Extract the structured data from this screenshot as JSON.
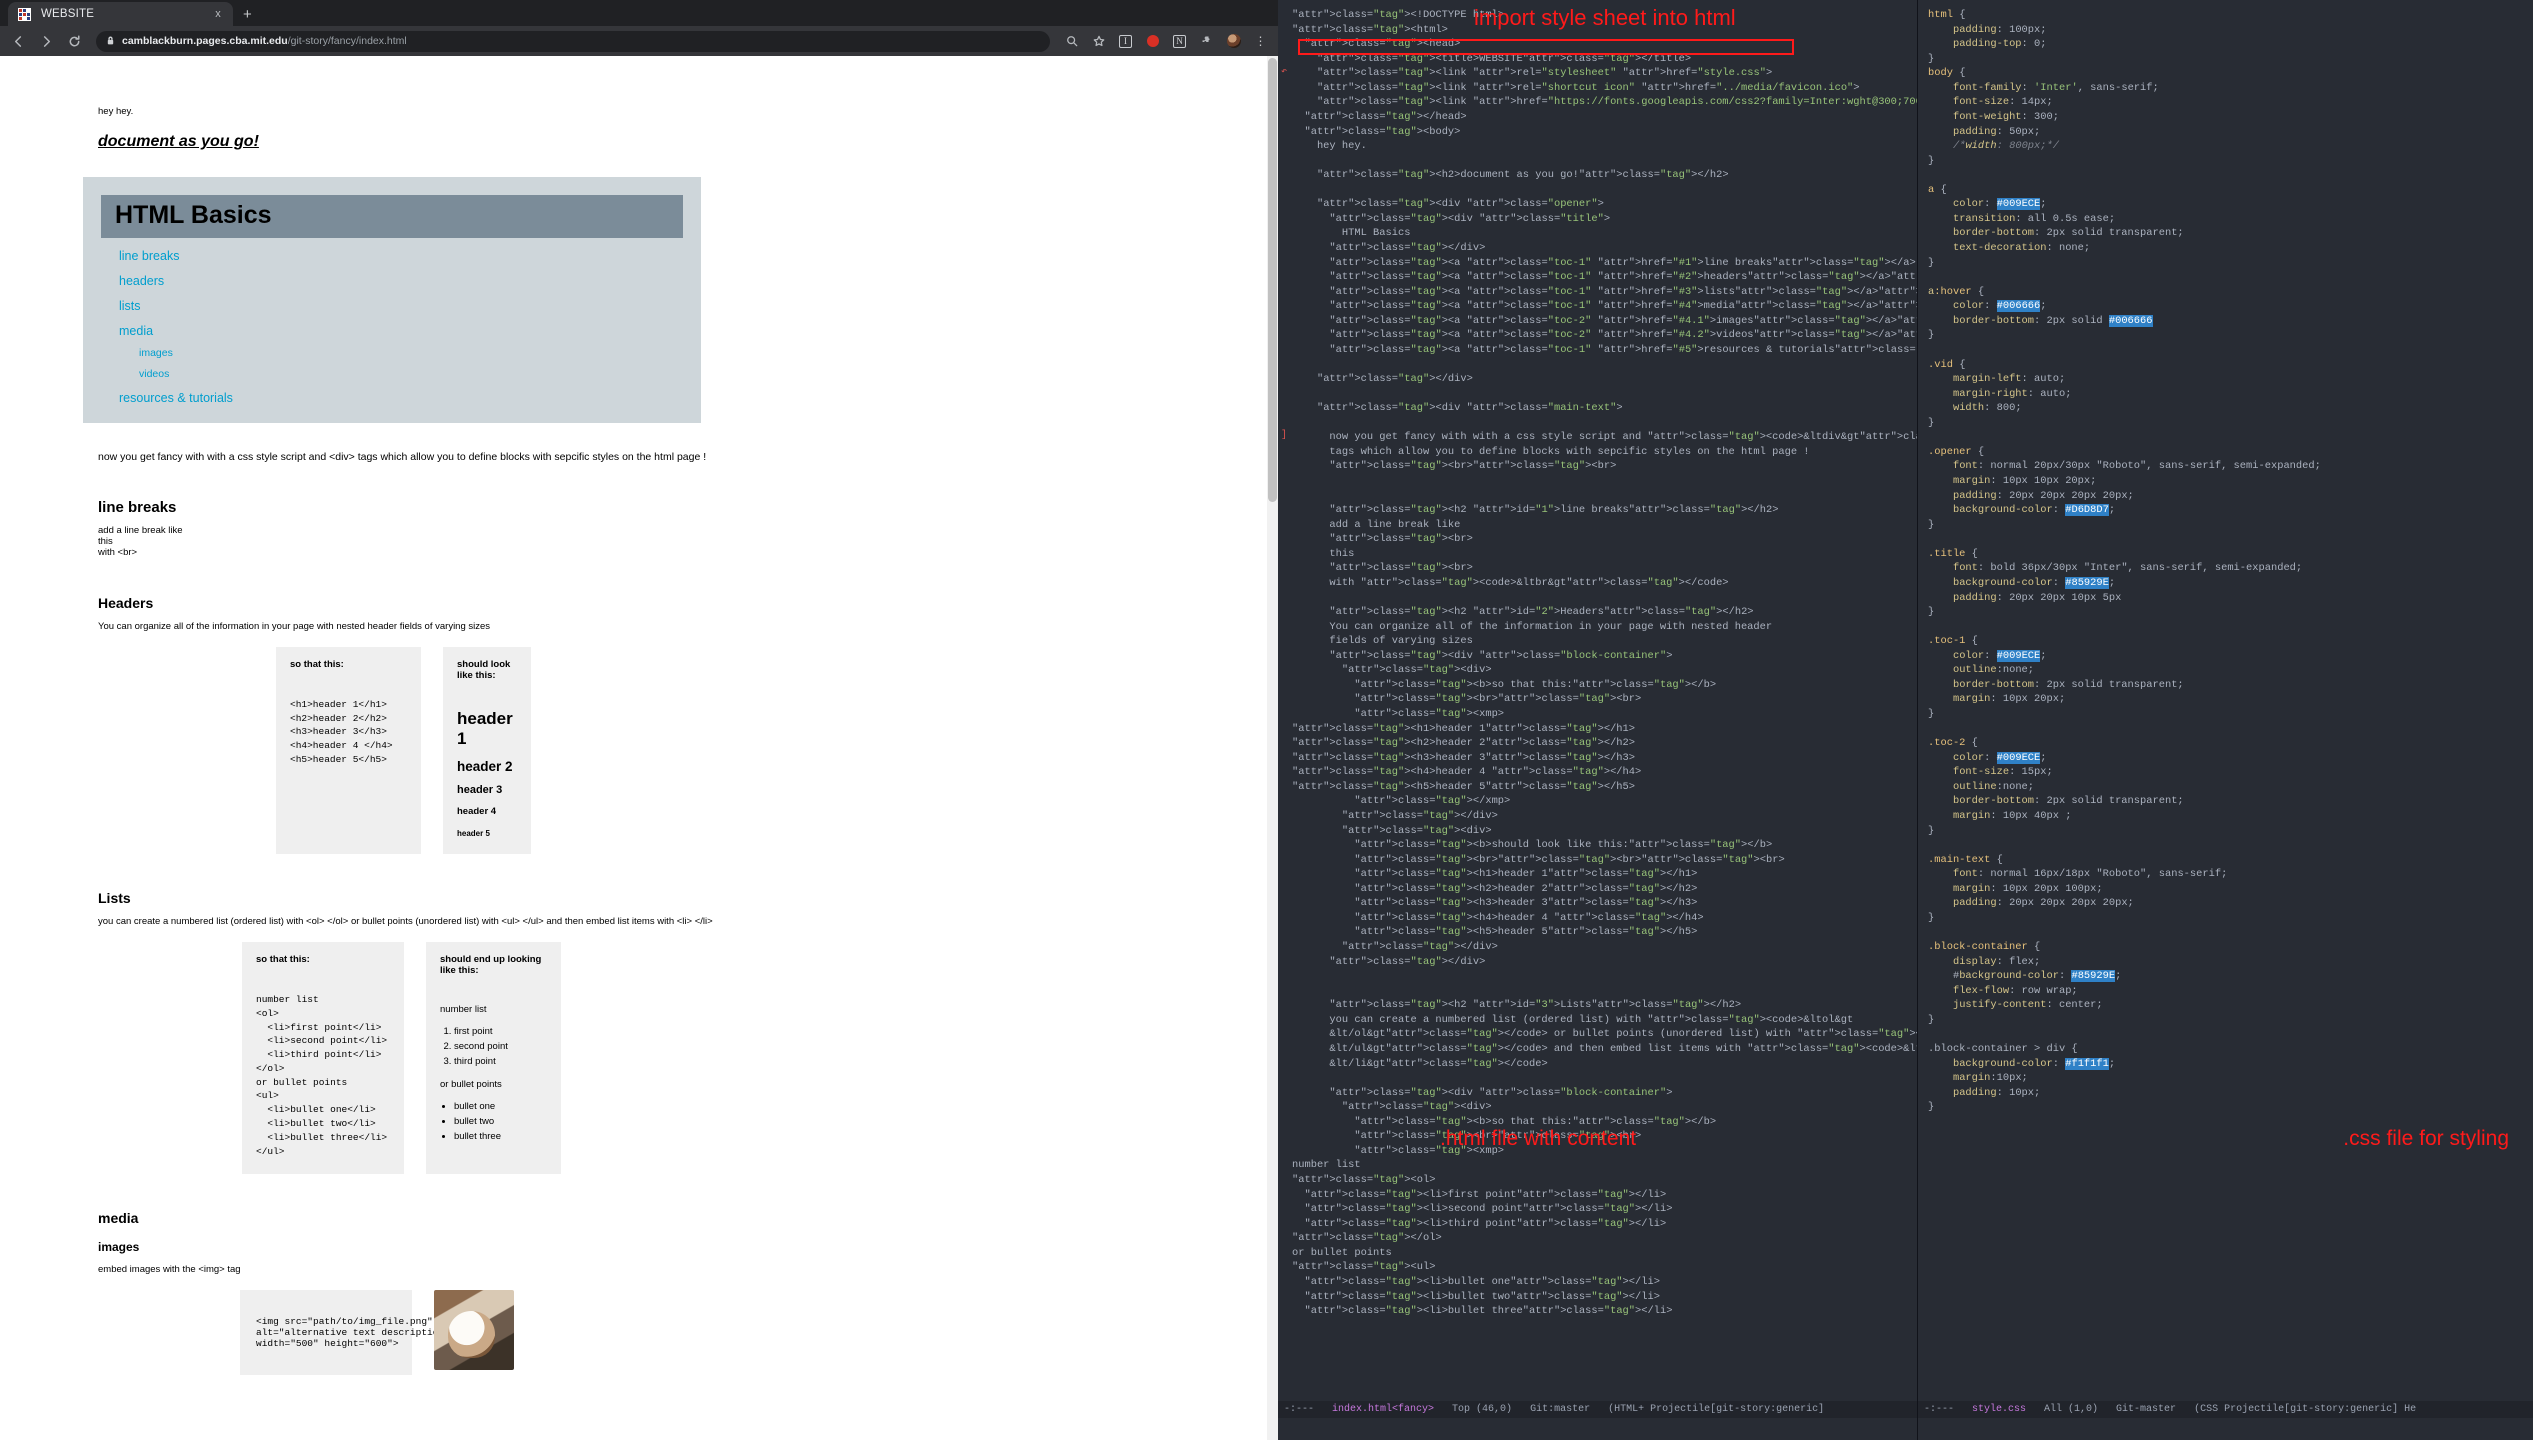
{
  "browser": {
    "tab": {
      "title": "WEBSITE",
      "close_label": "x",
      "favicon": "website-favicon"
    },
    "new_tab_label": "+",
    "nav": {
      "back": "←",
      "forward": "→",
      "reload": "↻"
    },
    "omnibox": {
      "domain": "camblackburn.pages.cba.mit.edu",
      "path": "/git-story/fancy/index.html",
      "lock_icon": "lock-icon"
    },
    "toolbar_icons": [
      "search-icon",
      "bookmark-star-icon",
      "info-badge-icon",
      "red-circle-icon",
      "notion-icon",
      "extensions-puzzle-icon",
      "profile-avatar",
      "chrome-menu-kebab"
    ]
  },
  "page": {
    "hey": "hey hey.",
    "h2": "document as you go!",
    "opener_title": "HTML Basics",
    "toc": [
      {
        "label": "line breaks",
        "level": 1
      },
      {
        "label": "headers",
        "level": 1
      },
      {
        "label": "lists",
        "level": 1
      },
      {
        "label": "media",
        "level": 1
      },
      {
        "label": "images",
        "level": 2
      },
      {
        "label": "videos",
        "level": 2
      },
      {
        "label": "resources & tutorials",
        "level": 1
      }
    ],
    "main_text": "now you get fancy with with a css style script and <div> tags which allow you to define blocks with sepcific styles on the html page !",
    "sections": [
      {
        "id": "line-breaks",
        "heading": "line breaks",
        "lines": [
          "add a line break like",
          "this",
          "with <br>"
        ]
      },
      {
        "id": "headers",
        "heading": "Headers",
        "para": "You can organize all of the information in your page with nested header fields of varying sizes",
        "left_title": "so that this:",
        "left_code": "<h1>header 1</h1>\n<h2>header 2</h2>\n<h3>header 3</h3>\n<h4>header 4 </h4>\n<h5>header 5</h5>",
        "right_title": "should look like this:",
        "preview": [
          "header 1",
          "header 2",
          "header 3",
          "header 4",
          "header 5"
        ]
      },
      {
        "id": "lists",
        "heading": "Lists",
        "para": "you can create a numbered list (ordered list) with <ol> </ol> or bullet points (unordered list) with <ul> </ul> and then embed list items with <li> </li>",
        "left_title": "so that this:",
        "left_code": "number list\n<ol>\n  <li>first point</li>\n  <li>second point</li>\n  <li>third point</li>\n</ol>\nor bullet points\n<ul>\n  <li>bullet one</li>\n  <li>bullet two</li>\n  <li>bullet three</li>\n</ul>",
        "right_title": "should end up looking like this:",
        "ordered_label": "number list",
        "ordered": [
          "first point",
          "second point",
          "third point"
        ],
        "unordered_label": "or bullet points",
        "unordered": [
          "bullet one",
          "bullet two",
          "bullet three"
        ]
      },
      {
        "id": "media",
        "heading": "media",
        "sub_heading": "images",
        "para": "embed images with the <img> tag",
        "img_code": "<img src=\"path/to/img_file.png\"\nalt=\"alternative text description\"\nwidth=\"500\" height=\"600\">",
        "photo_alt": "dog-photo"
      }
    ]
  },
  "editor": {
    "annotations": {
      "import": "import style sheet into html",
      "html_file": ".html file with content",
      "css_file": ".css file for styling"
    },
    "html_pane": {
      "code_lines": "<!DOCTYPE html>\n<html>\n  <head>\n    <title>WEBSITE</title>\n    <link rel=\"stylesheet\" href=\"style.css\">\n    <link rel=\"shortcut icon\" href=\"../media/favicon.ico\">\n    <link href=\"https://fonts.googleapis.com/css2?family=Inter:wght@300;700;400&display=swap\" rel=\"stylesheet\">\n  </head>\n  <body>\n    hey hey.\n\n    <h2>document as you go!</h2>\n\n    <div class=\"opener\">\n      <div class=\"title\">\n        HTML Basics\n      </div>\n      <a class=\"toc-1\" href=\"#1\">line breaks</a><br>\n      <a class=\"toc-1\" href=\"#2\">headers</a><br>\n      <a class=\"toc-1\" href=\"#3\">lists</a><br>\n      <a class=\"toc-1\" href=\"#4\">media</a><br>\n      <a class=\"toc-2\" href=\"#4.1\">images</a><br>\n      <a class=\"toc-2\" href=\"#4.2\">videos</a><br>\n      <a class=\"toc-1\" href=\"#5\">resources & tutorials</a><br>\n\n    </div>\n\n    <div class=\"main-text\">\n\n      now you get fancy with with a css style script and <code>&ltdiv&gt</code>\n      tags which allow you to define blocks with sepcific styles on the html page !\n      <br><br>\n\n\n      <h2 id=\"1\">line breaks</h2>\n      add a line break like\n      <br>\n      this\n      <br>\n      with <code>&ltbr&gt</code>\n\n      <h2 id=\"2\">Headers</h2>\n      You can organize all of the information in your page with nested header\n      fields of varying sizes\n      <div class=\"block-container\">\n        <div>\n          <b>so that this:</b>\n          <br><br>\n          <xmp>\n<h1>header 1</h1>\n<h2>header 2</h2>\n<h3>header 3</h3>\n<h4>header 4 </h4>\n<h5>header 5</h5>\n          </xmp>\n        </div>\n        <div>\n          <b>should look like this:</b>\n          <br><br><br>\n          <h1>header 1</h1>\n          <h2>header 2</h2>\n          <h3>header 3</h3>\n          <h4>header 4 </h4>\n          <h5>header 5</h5>\n        </div>\n      </div>\n\n\n      <h2 id=\"3\">Lists</h2>\n      you can create a numbered list (ordered list) with <code>&ltol&gt\n      &lt/ol&gt</code> or bullet points (unordered list) with <code>&ltul&gt\n      &lt/ul&gt</code> and then embed list items with <code>&ltli&gt\n      &lt/li&gt</code>\n\n      <div class=\"block-container\">\n        <div>\n          <b>so that this:</b>\n          <br><br>\n          <xmp>\nnumber list\n<ol>\n  <li>first point</li>\n  <li>second point</li>\n  <li>third point</li>\n</ol>\nor bullet points\n<ul>\n  <li>bullet one</li>\n  <li>bullet two</li>\n  <li>bullet three</li>"
    },
    "css_pane": {
      "code": "html {\n    padding: 100px;\n    padding-top: 0;\n}\nbody {\n    font-family: 'Inter', sans-serif;\n    font-size: 14px;\n    font-weight: 300;\n    padding: 50px;\n    /*width: 800px;*/\n}\n\na {\n    color: #009ECE;\n    transition: all 0.5s ease;\n    border-bottom: 2px solid transparent;\n    text-decoration: none;\n}\n\na:hover {\n    color: #006666;\n    border-bottom: 2px solid #006666\n}\n\n.vid {\n    margin-left: auto;\n    margin-right: auto;\n    width: 800;\n}\n\n.opener {\n    font: normal 20px/30px \"Roboto\", sans-serif, semi-expanded;\n    margin: 10px 10px 20px;\n    padding: 20px 20px 20px 20px;\n    background-color: #D6D8D7;\n}\n\n.title {\n    font: bold 36px/30px \"Inter\", sans-serif, semi-expanded;\n    background-color: #85929E;\n    padding: 20px 20px 10px 5px\n}\n\n.toc-1{\n    color: #009ECE;\n    outline:none;\n    border-bottom: 2px solid transparent;\n    margin: 10px 20px;\n}\n\n.toc-2{\n    color: #009ECE;\n    font-size: 15px;\n    outline:none;\n    border-bottom: 2px solid transparent;\n    margin: 10px 40px ;\n}\n\n.main-text {\n    font: normal 16px/18px \"Roboto\", sans-serif;\n    margin: 10px 20px 100px;\n    padding: 20px 20px 20px 20px;\n}\n\n.block-container {\n    display: flex;\n    #background-color: #85929E;\n    flex-flow: row wrap;\n    justify-content: center;\n}\n\n.block-container > div {\n    background-color: #f1f1f1;\n    margin:10px;\n    padding: 10px;\n}",
      "colors": [
        "#009ECE",
        "#006666",
        "#D6D8D7",
        "#85929E",
        "#f1f1f1"
      ]
    },
    "modeline_html": {
      "coding": "-:---",
      "file": "index.html<fancy>",
      "position": "Top (46,0)",
      "vc": "Git:master",
      "mode": "(HTML+ Projectile[git-story:generic]"
    },
    "modeline_css": {
      "coding": "-:---",
      "file": "style.css",
      "position": "All (1,0)",
      "vc": "Git-master",
      "mode": "(CSS Projectile[git-story:generic] He"
    }
  }
}
